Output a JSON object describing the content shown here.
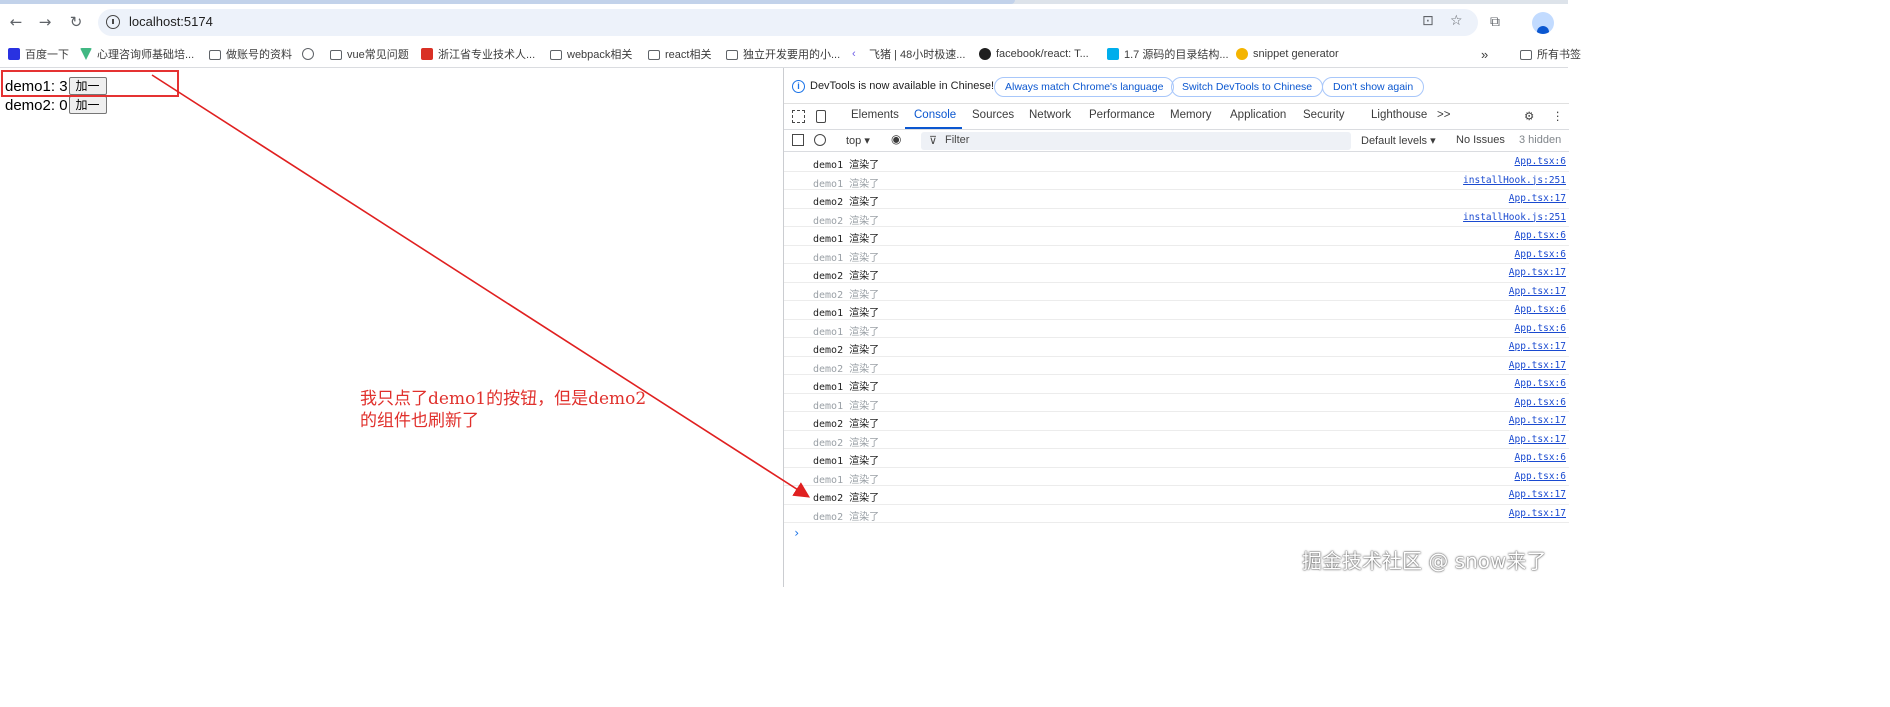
{
  "browser": {
    "url": "localhost:5174",
    "bookmarks": [
      "百度一下",
      "心理咨询师基础培...",
      "做账号的资料",
      "vue常见问题",
      "浙江省专业技术人...",
      "webpack相关",
      "react相关",
      "独立开发要用的小...",
      "飞猪 | 48小时极速...",
      "facebook/react: T...",
      "1.7 源码的目录结构...",
      "snippet generator",
      "所有书签"
    ],
    "overflow_icon": "»"
  },
  "page": {
    "demo1_label": "demo1: 3",
    "demo2_label": "demo2: 0",
    "button_label": "加一",
    "annotation_line1": "我只点了demo1的按钮，但是demo2",
    "annotation_line2": "的组件也刷新了",
    "annotation_color": "#e0302c"
  },
  "devtools": {
    "infobar_text": "DevTools is now available in Chinese!",
    "infobar_buttons": [
      "Always match Chrome's language",
      "Switch DevTools to Chinese",
      "Don't show again"
    ],
    "tabs": [
      "Elements",
      "Console",
      "Sources",
      "Network",
      "Performance",
      "Memory",
      "Application",
      "Security",
      "Lighthouse"
    ],
    "active_tab": "Console",
    "more_tabs": ">>",
    "context": "top",
    "filter_placeholder": "Filter",
    "default_levels": "Default levels",
    "no_issues": "No Issues",
    "hidden_count": "3 hidden",
    "logs": [
      {
        "text": "demo1 渲染了",
        "src": "App.tsx:6",
        "dim": false
      },
      {
        "text": "demo1 渲染了",
        "src": "installHook.js:251",
        "dim": true
      },
      {
        "text": "demo2 渲染了",
        "src": "App.tsx:17",
        "dim": false
      },
      {
        "text": "demo2 渲染了",
        "src": "installHook.js:251",
        "dim": true
      },
      {
        "text": "demo1 渲染了",
        "src": "App.tsx:6",
        "dim": false
      },
      {
        "text": "demo1 渲染了",
        "src": "App.tsx:6",
        "dim": true
      },
      {
        "text": "demo2 渲染了",
        "src": "App.tsx:17",
        "dim": false
      },
      {
        "text": "demo2 渲染了",
        "src": "App.tsx:17",
        "dim": true
      },
      {
        "text": "demo1 渲染了",
        "src": "App.tsx:6",
        "dim": false
      },
      {
        "text": "demo1 渲染了",
        "src": "App.tsx:6",
        "dim": true
      },
      {
        "text": "demo2 渲染了",
        "src": "App.tsx:17",
        "dim": false
      },
      {
        "text": "demo2 渲染了",
        "src": "App.tsx:17",
        "dim": true
      },
      {
        "text": "demo1 渲染了",
        "src": "App.tsx:6",
        "dim": false
      },
      {
        "text": "demo1 渲染了",
        "src": "App.tsx:6",
        "dim": true
      },
      {
        "text": "demo2 渲染了",
        "src": "App.tsx:17",
        "dim": false
      },
      {
        "text": "demo2 渲染了",
        "src": "App.tsx:17",
        "dim": true
      },
      {
        "text": "demo1 渲染了",
        "src": "App.tsx:6",
        "dim": false
      },
      {
        "text": "demo1 渲染了",
        "src": "App.tsx:6",
        "dim": true
      },
      {
        "text": "demo2 渲染了",
        "src": "App.tsx:17",
        "dim": false
      },
      {
        "text": "demo2 渲染了",
        "src": "App.tsx:17",
        "dim": true
      }
    ],
    "prompt": "›"
  },
  "watermark": "掘金技术社区 @ snow来了"
}
